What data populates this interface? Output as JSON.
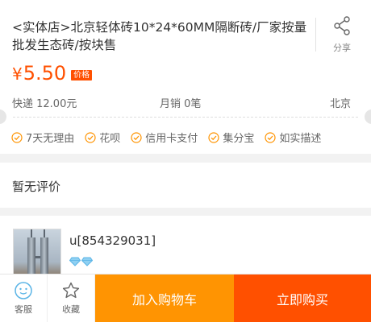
{
  "product": {
    "title": "<实体店>北京轻体砖10*24*60MM隔断砖/厂家按量批发生态砖/按块售",
    "share_label": "分享",
    "price_symbol": "¥",
    "price_value": "5.50",
    "price_tag": "价格",
    "shipping": "快递 12.00元",
    "monthly_sales": "月销 0笔",
    "location": "北京"
  },
  "services": [
    {
      "label": "7天无理由"
    },
    {
      "label": "花呗"
    },
    {
      "label": "信用卡支付"
    },
    {
      "label": "集分宝"
    },
    {
      "label": "如实描述"
    }
  ],
  "reviews": {
    "empty_text": "暂无评价"
  },
  "seller": {
    "name": "u[854329031]",
    "diamond_count": 2
  },
  "bottom_bar": {
    "service_label": "客服",
    "favorite_label": "收藏",
    "add_to_cart_label": "加入购物车",
    "buy_now_label": "立即购买"
  },
  "colors": {
    "accent": "#ff5000",
    "cart_button": "#ff9402",
    "service_badge": "#ff9402",
    "diamond": "#5ab4e6"
  },
  "icons": {
    "share": "share-icon",
    "check": "check-circle-icon",
    "diamond": "diamond-icon",
    "service": "customer-service-icon",
    "favorite": "star-icon"
  }
}
